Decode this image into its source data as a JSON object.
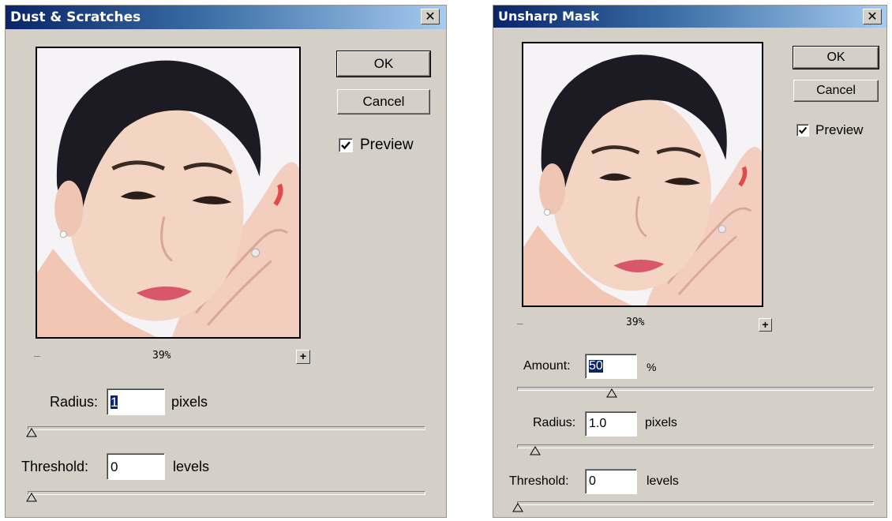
{
  "dust": {
    "title": "Dust & Scratches",
    "ok_label": "OK",
    "cancel_label": "Cancel",
    "preview_label": "Preview",
    "preview_checked": true,
    "zoom_minus": "–",
    "zoom_level": "39%",
    "zoom_plus": "+",
    "radius": {
      "label": "Radius:",
      "value": "1",
      "unit": "pixels",
      "slider_fraction": 0.0
    },
    "threshold": {
      "label": "Threshold:",
      "value": "0",
      "unit": "levels",
      "slider_fraction": 0.0
    }
  },
  "unsharp": {
    "title": "Unsharp Mask",
    "ok_label": "OK",
    "cancel_label": "Cancel",
    "preview_label": "Preview",
    "preview_checked": true,
    "zoom_minus": "–",
    "zoom_level": "39%",
    "zoom_plus": "+",
    "amount": {
      "label": "Amount:",
      "value": "50",
      "unit": "%",
      "slider_fraction": 0.27
    },
    "radius": {
      "label": "Radius:",
      "value": "1.0",
      "unit": "pixels",
      "slider_fraction": 0.05
    },
    "threshold": {
      "label": "Threshold:",
      "value": "0",
      "unit": "levels",
      "slider_fraction": 0.0
    }
  },
  "colors": {
    "titlebar_start": "#0a246a",
    "dialog_bg": "#d4d0c8",
    "selection": "#0a246a"
  }
}
